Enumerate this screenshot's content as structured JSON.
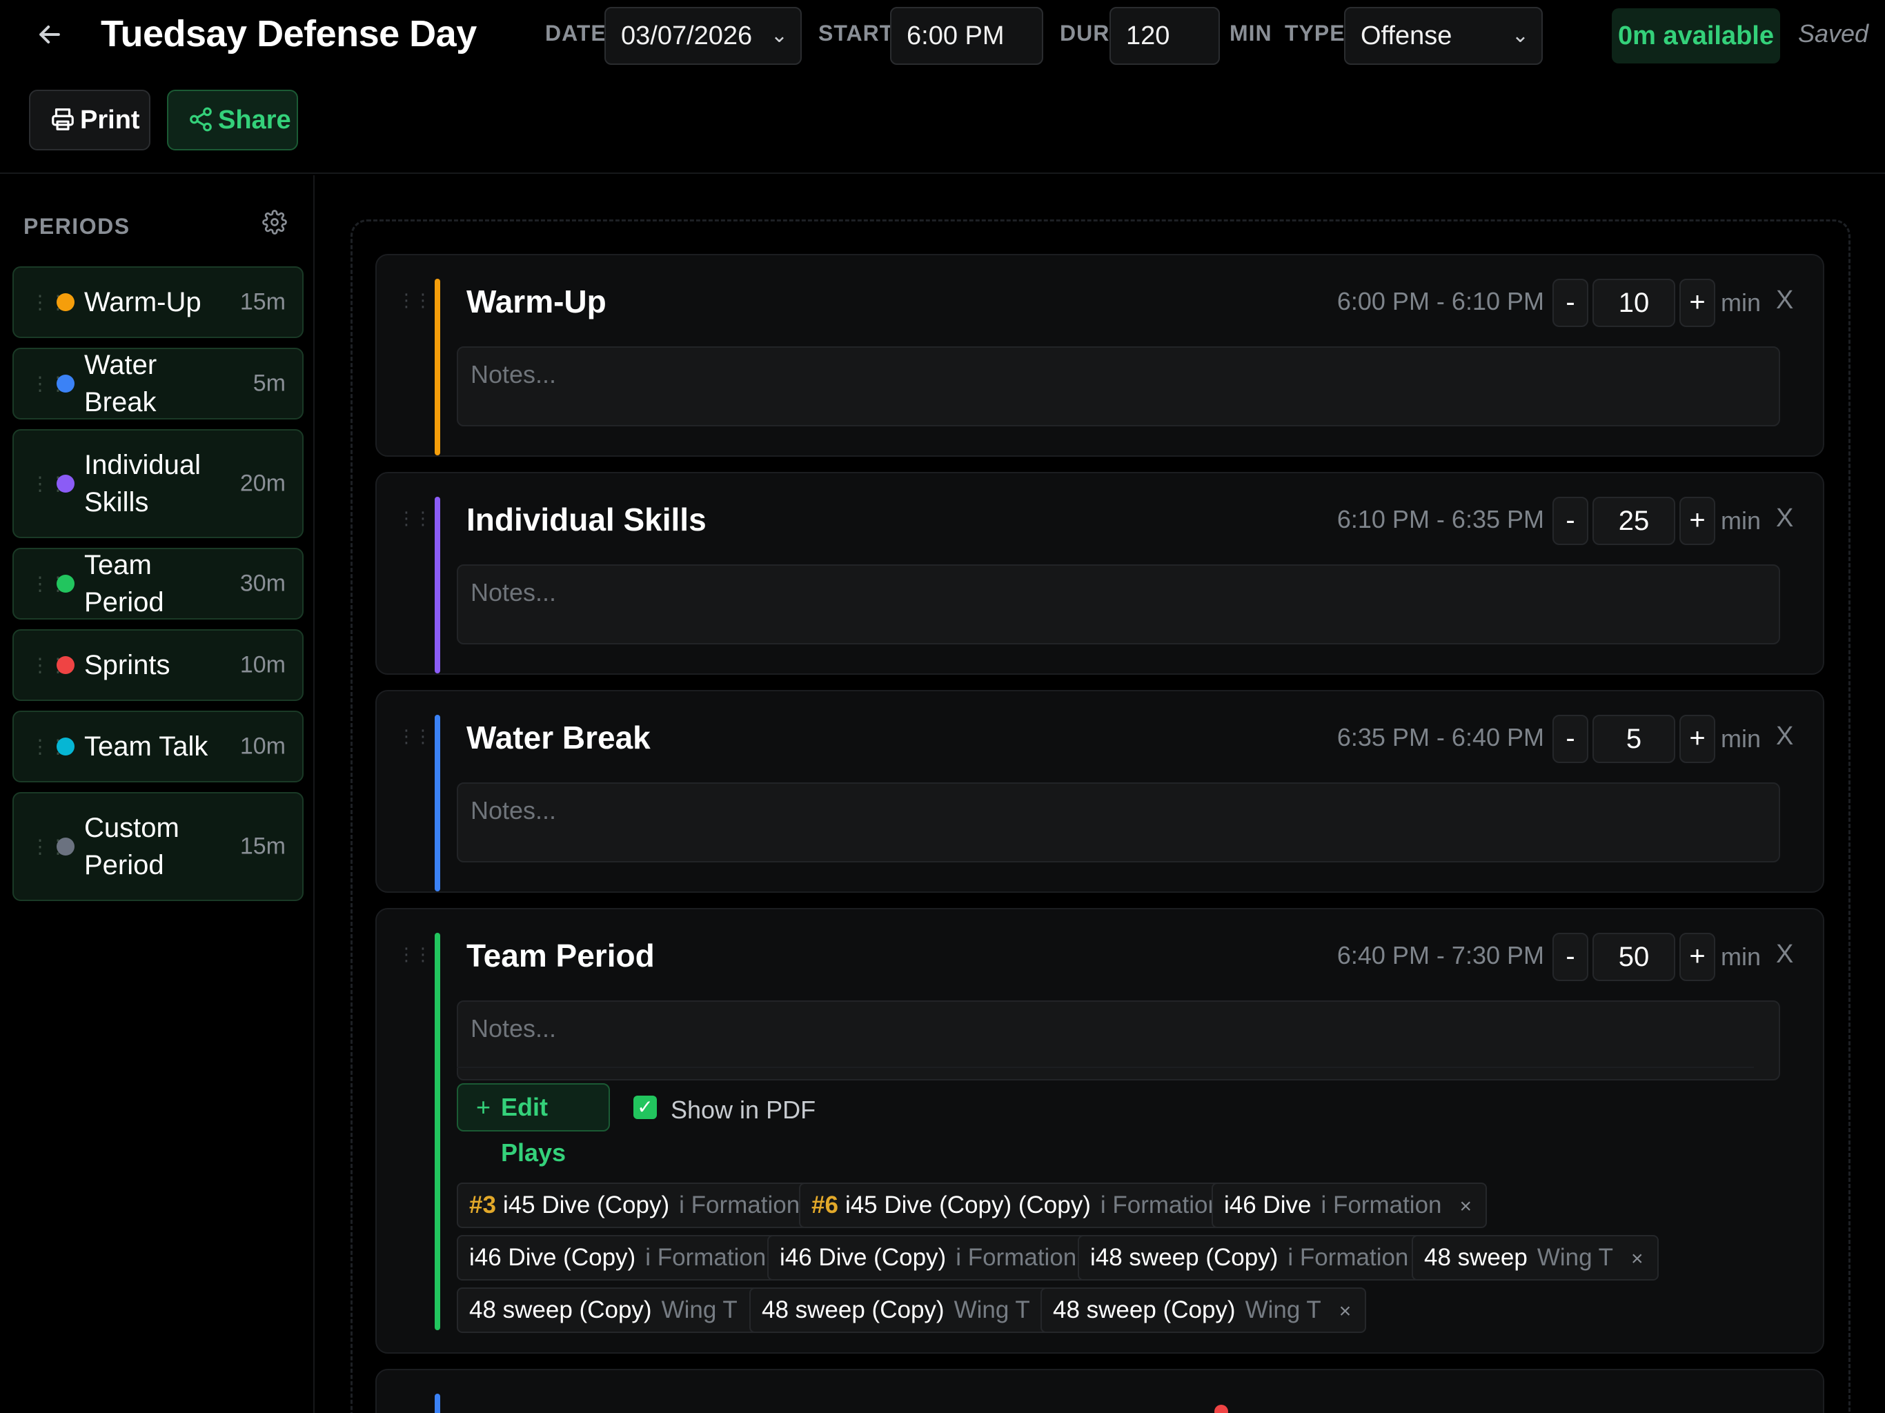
{
  "header": {
    "title": "Tuedsay Defense Day",
    "date_label": "DATE",
    "date_value": "03/07/2026",
    "start_label": "START",
    "start_value": "6:00 PM",
    "dur_label": "DUR",
    "dur_value": "120",
    "min_label": "MIN",
    "type_label": "TYPE",
    "type_value": "Offense",
    "available": "0m available",
    "saved": "Saved",
    "print_label": "Print",
    "share_label": "Share"
  },
  "sidebar": {
    "title": "PERIODS",
    "items": [
      {
        "label": "Warm-Up",
        "minutes": "15m",
        "color": "#f59e0b"
      },
      {
        "label": "Water Break",
        "minutes": "5m",
        "color": "#3b82f6"
      },
      {
        "label": "Individual Skills",
        "minutes": "20m",
        "color": "#8b5cf6"
      },
      {
        "label": "Team Period",
        "minutes": "30m",
        "color": "#22c55e"
      },
      {
        "label": "Sprints",
        "minutes": "10m",
        "color": "#ef4444"
      },
      {
        "label": "Team Talk",
        "minutes": "10m",
        "color": "#06b6d4"
      },
      {
        "label": "Custom Period",
        "minutes": "15m",
        "color": "#6b7280"
      }
    ]
  },
  "schedule": {
    "minus_label": "-",
    "plus_label": "+",
    "unit_label": "min",
    "remove_label": "X",
    "notes_placeholder": "Notes...",
    "periods": [
      {
        "title": "Warm-Up",
        "time": "6:00 PM - 6:10 PM",
        "duration": "10",
        "color": "#f59e0b"
      },
      {
        "title": "Individual Skills",
        "time": "6:10 PM - 6:35 PM",
        "duration": "25",
        "color": "#8b5cf6"
      },
      {
        "title": "Water Break",
        "time": "6:35 PM - 6:40 PM",
        "duration": "5",
        "color": "#3b82f6"
      },
      {
        "title": "Team Period",
        "time": "6:40 PM - 7:30 PM",
        "duration": "50",
        "color": "#22c55e"
      }
    ],
    "team_period": {
      "edit_plays_label": "Edit Plays",
      "show_in_pdf_label": "Show in PDF",
      "show_in_pdf_checked": true,
      "plays": [
        {
          "num": "#3",
          "name": "i45 Dive (Copy)",
          "formation": "i Formation"
        },
        {
          "num": "#6",
          "name": "i45 Dive (Copy) (Copy)",
          "formation": "i Formation"
        },
        {
          "num": "",
          "name": "i46 Dive",
          "formation": "i Formation"
        },
        {
          "num": "",
          "name": "i46 Dive (Copy)",
          "formation": "i Formation"
        },
        {
          "num": "",
          "name": "i46 Dive (Copy)",
          "formation": "i Formation"
        },
        {
          "num": "",
          "name": "i48 sweep (Copy)",
          "formation": "i Formation"
        },
        {
          "num": "",
          "name": "48 sweep",
          "formation": "Wing T"
        },
        {
          "num": "",
          "name": "48 sweep (Copy)",
          "formation": "Wing T"
        },
        {
          "num": "",
          "name": "48 sweep (Copy)",
          "formation": "Wing T"
        },
        {
          "num": "",
          "name": "48 sweep (Copy)",
          "formation": "Wing T"
        }
      ],
      "remove_chip_label": "×"
    }
  },
  "icons": {
    "back": "arrow-left-icon",
    "print": "printer-icon",
    "share": "share-icon",
    "settings": "gear-icon",
    "grip": "drag-handle-icon"
  }
}
